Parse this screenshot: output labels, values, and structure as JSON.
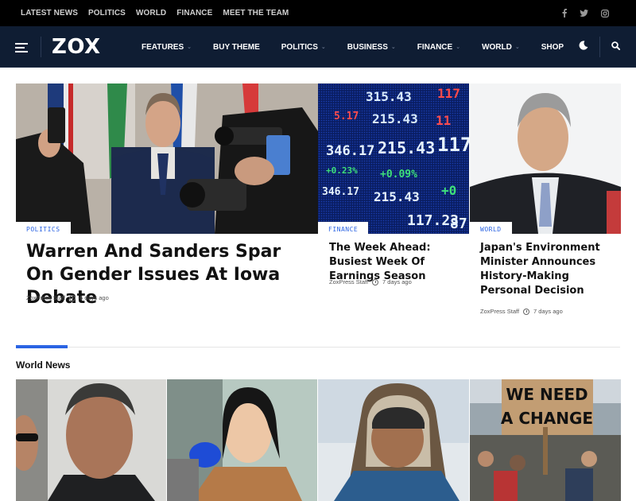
{
  "topbar": {
    "links": [
      "LATEST NEWS",
      "POLITICS",
      "WORLD",
      "FINANCE",
      "MEET THE TEAM"
    ],
    "social": [
      "facebook-icon",
      "twitter-icon",
      "instagram-icon"
    ]
  },
  "nav": {
    "logo": "ZOX",
    "menu": [
      "FEATURES",
      "BUY THEME",
      "POLITICS",
      "BUSINESS",
      "FINANCE",
      "WORLD",
      "SHOP"
    ],
    "icons": [
      "moon-icon",
      "search-icon"
    ]
  },
  "features": [
    {
      "tag": "POLITICS",
      "title": "Warren And Sanders Spar On Gender Issues At Iowa Debate",
      "author": "ZoxPress Staff",
      "time": "6 days ago"
    },
    {
      "tag": "FINANCE",
      "title": "The Week Ahead: Busiest Week Of Earnings Season",
      "author": "ZoxPress Staff",
      "time": "7 days ago"
    },
    {
      "tag": "WORLD",
      "title": "Japan's Environment Minister Announces History-Making Personal Decision",
      "author": "ZoxPress Staff",
      "time": "7 days ago"
    }
  ],
  "ticker": {
    "row1": [
      "315.43",
      "117"
    ],
    "row2": [
      "5.17",
      "215.43",
      "11"
    ],
    "row3": [
      "346.17",
      "215.43",
      "117"
    ],
    "row4": [
      "+0.23%",
      "+0.09%",
      "+0"
    ],
    "row5": [
      "346.17",
      "215.43",
      "117.23",
      "87"
    ]
  },
  "section": {
    "title": "World News",
    "sign": [
      "WE NEED",
      "A CHANGE"
    ]
  },
  "colors": {
    "accent": "#2b64e3",
    "nav_bg": "#0f1d33",
    "topbar_bg": "#000000"
  }
}
